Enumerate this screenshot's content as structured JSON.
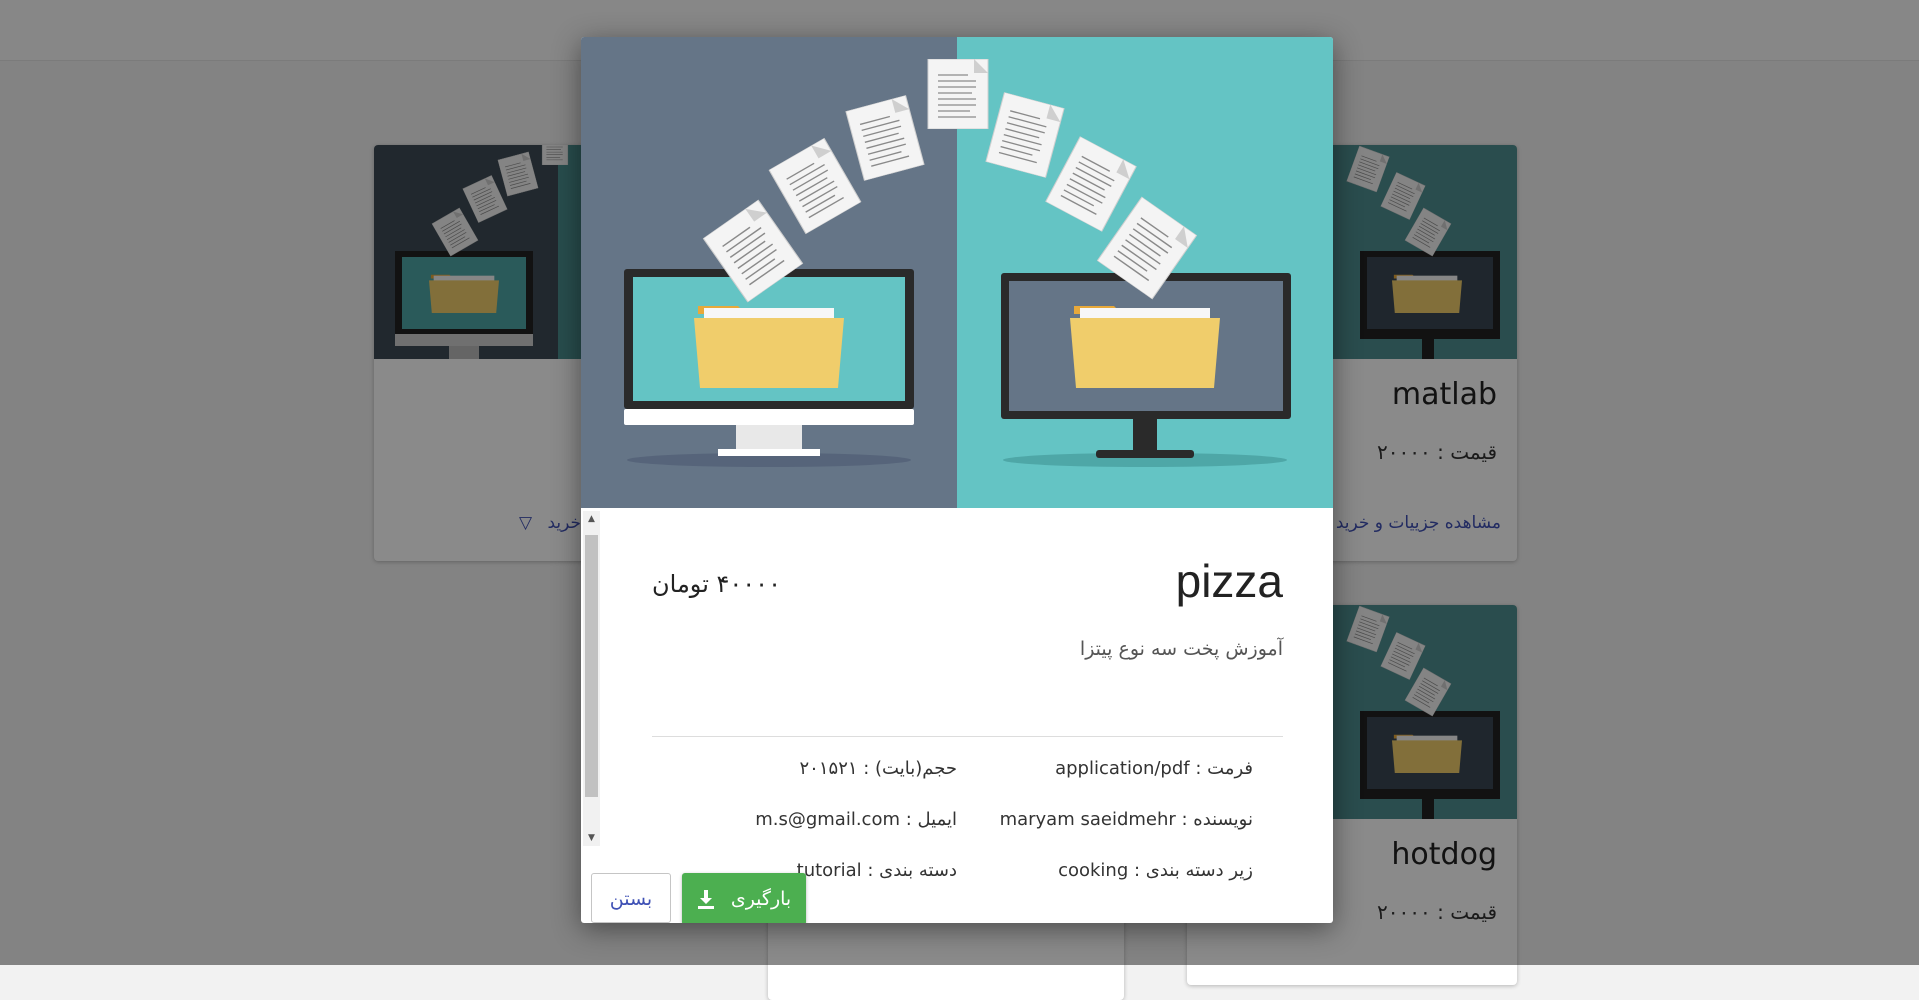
{
  "background_cards": [
    {
      "title": "",
      "price": "",
      "link": "خرید",
      "link_icon": "triangle-down-icon"
    },
    {
      "title": "matlab",
      "price": "قیمت : ۲۰۰۰۰",
      "link": "مشاهده جزییات و خرید"
    },
    {
      "title": "hotdog",
      "price": "قیمت : ۲۰۰۰۰",
      "link": ""
    }
  ],
  "modal": {
    "title": "pizza",
    "price": "۴۰۰۰۰ تومان",
    "description": "آموزش پخت سه نوع پیتزا",
    "meta": {
      "format": "فرمت : application/pdf",
      "size": "حجم(بایت) : ۲۰۱۵۲۱",
      "author": "نویسنده : maryam saeidmehr",
      "email": "ایمیل : m.s@gmail.com",
      "subcategory": "زیر دسته بندی : cooking",
      "category": "دسته بندی : tutorial"
    },
    "buttons": {
      "download": "بارگیری",
      "download_icon": "download-icon",
      "close": "بستن"
    }
  },
  "colors": {
    "hero_left": "#657587",
    "hero_right": "#64c4c4",
    "download_button": "#4caf50",
    "link": "#3f51b5"
  }
}
